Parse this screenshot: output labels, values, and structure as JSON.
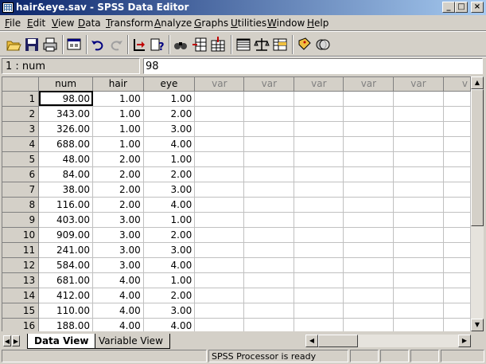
{
  "window": {
    "title": "hair&eye.sav - SPSS Data Editor",
    "controls": [
      "_",
      "□",
      "×"
    ]
  },
  "menu": [
    {
      "label": "File",
      "key": "F"
    },
    {
      "label": "Edit",
      "key": "E"
    },
    {
      "label": "View",
      "key": "V"
    },
    {
      "label": "Data",
      "key": "D"
    },
    {
      "label": "Transform",
      "key": "T"
    },
    {
      "label": "Analyze",
      "key": "A"
    },
    {
      "label": "Graphs",
      "key": "G"
    },
    {
      "label": "Utilities",
      "key": "U"
    },
    {
      "label": "Window",
      "key": "W"
    },
    {
      "label": "Help",
      "key": "H"
    }
  ],
  "toolbar": [
    {
      "name": "open-file-icon"
    },
    {
      "name": "save-icon"
    },
    {
      "name": "print-icon"
    },
    {
      "name": "dialog-recall-icon"
    },
    {
      "name": "undo-icon"
    },
    {
      "name": "redo-icon"
    },
    {
      "name": "goto-case-icon"
    },
    {
      "name": "variables-icon"
    },
    {
      "name": "find-icon"
    },
    {
      "name": "insert-case-icon"
    },
    {
      "name": "insert-variable-icon"
    },
    {
      "name": "split-file-icon"
    },
    {
      "name": "weight-cases-icon"
    },
    {
      "name": "select-cases-icon"
    },
    {
      "name": "value-labels-icon"
    },
    {
      "name": "use-sets-icon"
    }
  ],
  "cell_editor": {
    "name": "1 : num",
    "value": "98"
  },
  "grid": {
    "columns": [
      "num",
      "hair",
      "eye",
      "var",
      "var",
      "var",
      "var",
      "var",
      "v"
    ],
    "rows": [
      {
        "n": "1",
        "cells": [
          "98.00",
          "1.00",
          "1.00"
        ]
      },
      {
        "n": "2",
        "cells": [
          "343.00",
          "1.00",
          "2.00"
        ]
      },
      {
        "n": "3",
        "cells": [
          "326.00",
          "1.00",
          "3.00"
        ]
      },
      {
        "n": "4",
        "cells": [
          "688.00",
          "1.00",
          "4.00"
        ]
      },
      {
        "n": "5",
        "cells": [
          "48.00",
          "2.00",
          "1.00"
        ]
      },
      {
        "n": "6",
        "cells": [
          "84.00",
          "2.00",
          "2.00"
        ]
      },
      {
        "n": "7",
        "cells": [
          "38.00",
          "2.00",
          "3.00"
        ]
      },
      {
        "n": "8",
        "cells": [
          "116.00",
          "2.00",
          "4.00"
        ]
      },
      {
        "n": "9",
        "cells": [
          "403.00",
          "3.00",
          "1.00"
        ]
      },
      {
        "n": "10",
        "cells": [
          "909.00",
          "3.00",
          "2.00"
        ]
      },
      {
        "n": "11",
        "cells": [
          "241.00",
          "3.00",
          "3.00"
        ]
      },
      {
        "n": "12",
        "cells": [
          "584.00",
          "3.00",
          "4.00"
        ]
      },
      {
        "n": "13",
        "cells": [
          "681.00",
          "4.00",
          "1.00"
        ]
      },
      {
        "n": "14",
        "cells": [
          "412.00",
          "4.00",
          "2.00"
        ]
      },
      {
        "n": "15",
        "cells": [
          "110.00",
          "4.00",
          "3.00"
        ]
      },
      {
        "n": "16",
        "cells": [
          "188.00",
          "4.00",
          "4.00"
        ]
      }
    ]
  },
  "tabs": {
    "data_view": "Data View",
    "variable_view": "Variable View"
  },
  "status": {
    "processor": "SPSS Processor  is ready"
  },
  "colors": {
    "title_active": "#0a246a",
    "face": "#d4d0c8"
  }
}
